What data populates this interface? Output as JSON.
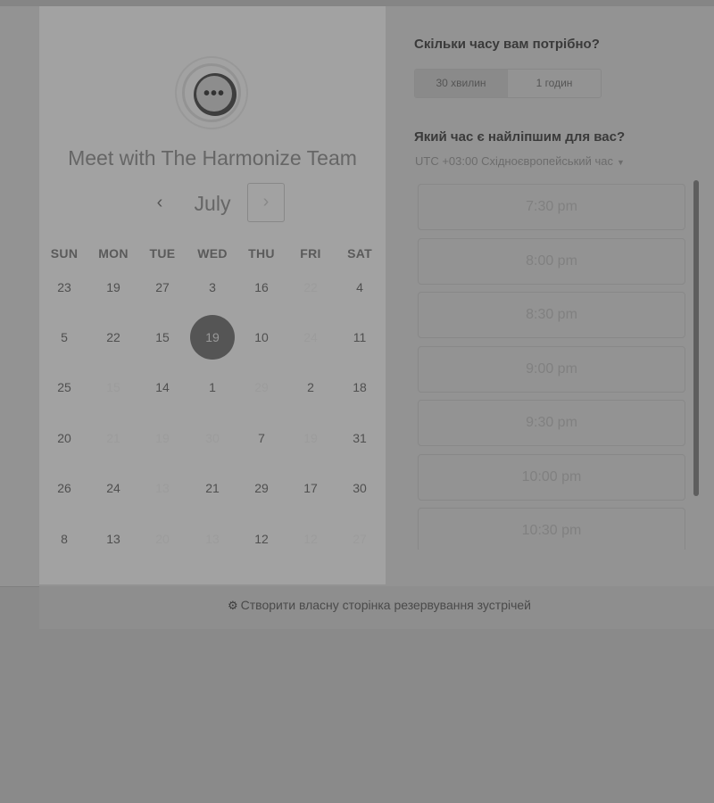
{
  "booking": {
    "title": "Meet with The Harmonize Team",
    "month": "July",
    "prev_symbol": "‹",
    "next_symbol": "›",
    "weekdays": [
      "SUN",
      "MON",
      "TUE",
      "WED",
      "THU",
      "FRI",
      "SAT"
    ],
    "weeks": [
      [
        {
          "d": "23"
        },
        {
          "d": "19"
        },
        {
          "d": "27"
        },
        {
          "d": "3"
        },
        {
          "d": "16"
        },
        {
          "d": "22",
          "muted": true
        },
        {
          "d": "4"
        }
      ],
      [
        {
          "d": "5"
        },
        {
          "d": "22"
        },
        {
          "d": "15"
        },
        {
          "d": "19",
          "selected": true
        },
        {
          "d": "10"
        },
        {
          "d": "24",
          "muted": true
        },
        {
          "d": "11"
        }
      ],
      [
        {
          "d": "25"
        },
        {
          "d": "15",
          "muted": true
        },
        {
          "d": "14"
        },
        {
          "d": "1"
        },
        {
          "d": "29",
          "muted": true
        },
        {
          "d": "2"
        },
        {
          "d": "18"
        }
      ],
      [
        {
          "d": "20"
        },
        {
          "d": "21",
          "muted": true
        },
        {
          "d": "19",
          "muted": true
        },
        {
          "d": "30",
          "muted": true
        },
        {
          "d": "7"
        },
        {
          "d": "19",
          "muted": true
        },
        {
          "d": "31"
        }
      ],
      [
        {
          "d": "26"
        },
        {
          "d": "24"
        },
        {
          "d": "13",
          "muted": true
        },
        {
          "d": "21"
        },
        {
          "d": "29"
        },
        {
          "d": "17"
        },
        {
          "d": "30"
        }
      ],
      [
        {
          "d": "8"
        },
        {
          "d": "13"
        },
        {
          "d": "20",
          "muted": true
        },
        {
          "d": "13",
          "muted": true
        },
        {
          "d": "12"
        },
        {
          "d": "12",
          "muted": true
        },
        {
          "d": "27",
          "muted": true
        }
      ]
    ]
  },
  "duration": {
    "heading": "Скільки часу вам потрібно?",
    "options": [
      "30 хвилин",
      "1 годин"
    ],
    "selected": "30 хвилин"
  },
  "time": {
    "heading": "Який час є найліпшим для вас?",
    "timezone": "UTC +03:00 Східноєвропейський час",
    "slots": [
      "7:30 pm",
      "8:00 pm",
      "8:30 pm",
      "9:00 pm",
      "9:30 pm",
      "10:00 pm",
      "10:30 pm"
    ]
  },
  "footer": {
    "icon": "hubspot-sprocket-icon",
    "link": "Створити власну сторінка резервування зустрічей"
  }
}
